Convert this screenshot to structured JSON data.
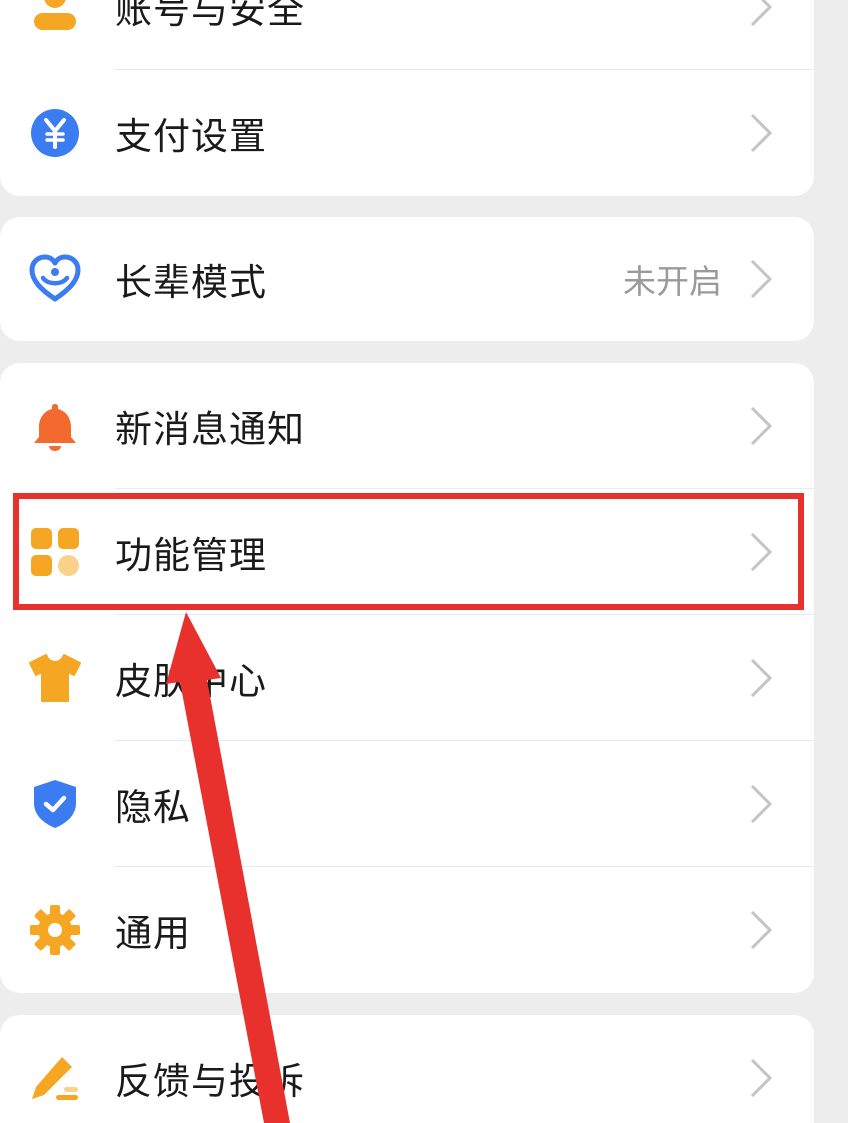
{
  "cards": [
    {
      "items": [
        {
          "label": "账号与安全",
          "icon": "user-icon"
        },
        {
          "label": "支付设置",
          "icon": "yuan-icon"
        }
      ]
    },
    {
      "items": [
        {
          "label": "长辈模式",
          "icon": "heart-icon",
          "value": "未开启"
        }
      ]
    },
    {
      "items": [
        {
          "label": "新消息通知",
          "icon": "bell-icon"
        },
        {
          "label": "功能管理",
          "icon": "grid-icon"
        },
        {
          "label": "皮肤中心",
          "icon": "tshirt-icon"
        },
        {
          "label": "隐私",
          "icon": "shield-check-icon"
        },
        {
          "label": "通用",
          "icon": "gear-icon"
        }
      ]
    },
    {
      "items": [
        {
          "label": "反馈与投诉",
          "icon": "pencil-icon"
        }
      ]
    }
  ],
  "colors": {
    "background": "#ededed",
    "card": "#ffffff",
    "annotation_red": "#e8302c",
    "orange": "#f5a623",
    "blue": "#3b7cf0",
    "bell_orange": "#f26a2e"
  }
}
